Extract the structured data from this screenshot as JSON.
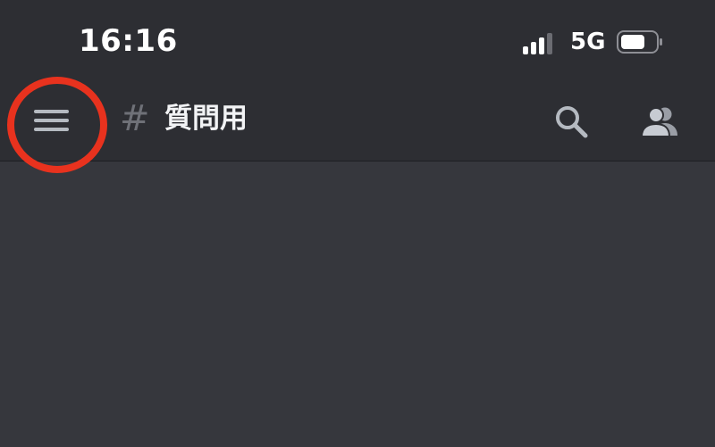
{
  "status_bar": {
    "time": "16:16",
    "network": "5G",
    "signal_bars": 4,
    "signal_active": 3,
    "battery_level": 0.6
  },
  "header": {
    "channel_prefix": "#",
    "channel_name": "質問用",
    "menu_icon": "hamburger-menu-icon",
    "search_icon": "search-icon",
    "members_icon": "members-icon"
  },
  "annotation": {
    "highlight_color": "#e8321e"
  },
  "colors": {
    "header_bg": "#2d2e33",
    "content_bg": "#36373d",
    "icon": "#b5bac1"
  }
}
